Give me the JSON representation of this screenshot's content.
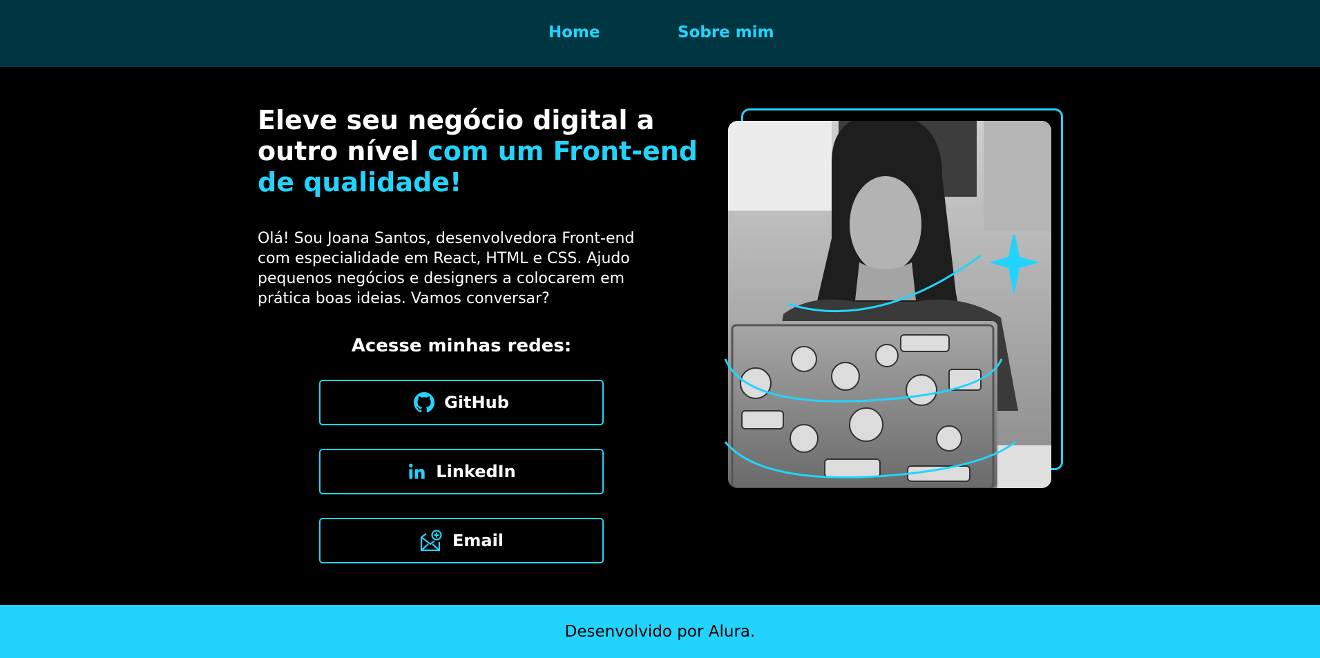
{
  "nav": {
    "home": "Home",
    "about": "Sobre mim"
  },
  "hero": {
    "headline_white": "Eleve seu negócio digital a outro nível",
    "headline_accent": "com um Front-end de qualidade!",
    "intro": "Olá! Sou Joana Santos, desenvolvedora Front-end com especialidade em React, HTML e CSS. Ajudo pequenos negócios e designers a colocarem em prática boas ideias. Vamos conversar?",
    "image_alt": "Joana Santos sorrindo em frente a um notebook com adesivos"
  },
  "social": {
    "title": "Acesse minhas redes:",
    "links": [
      {
        "label": "GitHub",
        "icon": "github-icon"
      },
      {
        "label": "LinkedIn",
        "icon": "linkedin-icon"
      },
      {
        "label": "Email",
        "icon": "email-icon"
      }
    ]
  },
  "footer": {
    "text": "Desenvolvido por Alura."
  },
  "colors": {
    "accent": "#22d4fd",
    "header_bg": "#003542",
    "page_bg": "#000000"
  }
}
